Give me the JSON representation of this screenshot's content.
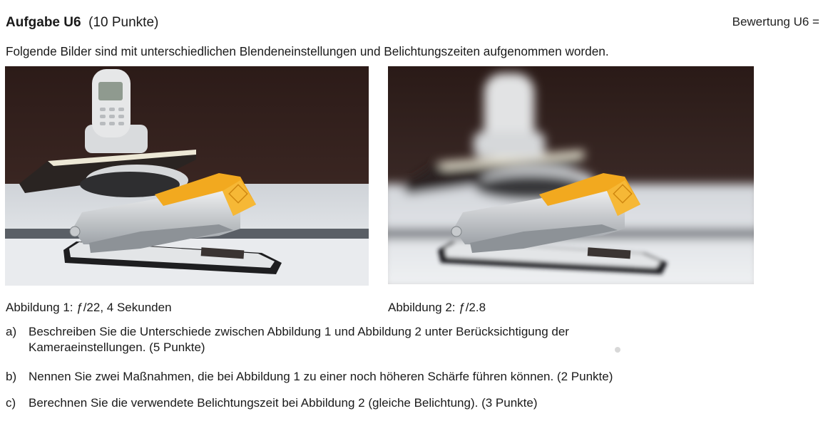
{
  "header": {
    "task_id": "Aufgabe U6",
    "points": "(10 Punkte)",
    "rating": "Bewertung U6 ="
  },
  "intro": "Folgende Bilder sind mit unterschiedlichen Blendeneinstellungen und Belichtungszeiten aufgenommen worden.",
  "figures": [
    {
      "caption": "Abbildung 1: ƒ/22, 4 Sekunden"
    },
    {
      "caption": "Abbildung 2: ƒ/2.8"
    }
  ],
  "tasks": [
    {
      "letter": "a)",
      "text": "Beschreiben Sie die Unterschiede zwischen Abbildung 1 und Abbildung 2 unter Berücksichtigung der",
      "text2": "Kameraeinstellungen. (5 Punkte)"
    },
    {
      "letter": "b)",
      "text": "Nennen Sie zwei Maßnahmen, die bei Abbildung 1 zu einer noch höheren Schärfe führen können. (2 Punkte)"
    },
    {
      "letter": "c)",
      "text": "Berechnen Sie die verwendete Belichtungszeit bei Abbildung 2 (gleiche Belichtung). (3 Punkte)"
    }
  ],
  "colors": {
    "stapler_handle": "#f2a91f",
    "background_dark": "#2a1a17"
  }
}
